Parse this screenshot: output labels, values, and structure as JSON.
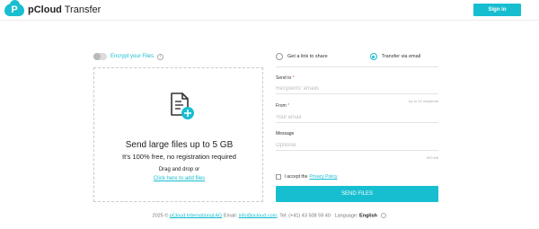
{
  "header": {
    "logo_brand": "pCloud",
    "logo_suffix": "Transfer",
    "signin_label": "Sign in"
  },
  "encrypt": {
    "label": "Encrypt your Files",
    "enabled": false,
    "info_icon": "info-icon"
  },
  "dropzone": {
    "icon": "file-add-icon",
    "title": "Send large files up to 5 GB",
    "subtitle": "It's 100% free, no registration required",
    "drag_text": "Drag and drop or",
    "link_text": "Click here to add files"
  },
  "options": {
    "link_label": "Get a link to share",
    "email_label": "Transfer via email",
    "selected": "email"
  },
  "form": {
    "send_to_label": "Send to",
    "send_to_placeholder": "Recipients' emails",
    "send_to_hint": "Up to 10 recipients",
    "from_label": "From",
    "from_placeholder": "Your email",
    "message_label": "Message",
    "message_placeholder": "Optional",
    "message_hint": "500 left",
    "required_mark": "*"
  },
  "accept": {
    "text": "I accept the",
    "policy": "Privacy Policy",
    "checked": false
  },
  "send_button": "SEND FILES",
  "footer": {
    "copyright": "2025 ©",
    "company": "pCloud International AG",
    "email_label": "Email:",
    "email": "info@pcloud.com",
    "tel": "Tel: (+41) 43 508 59 40",
    "language_label": "Language:",
    "language": "English"
  },
  "colors": {
    "accent": "#17bed0",
    "required": "#e84c4c"
  }
}
